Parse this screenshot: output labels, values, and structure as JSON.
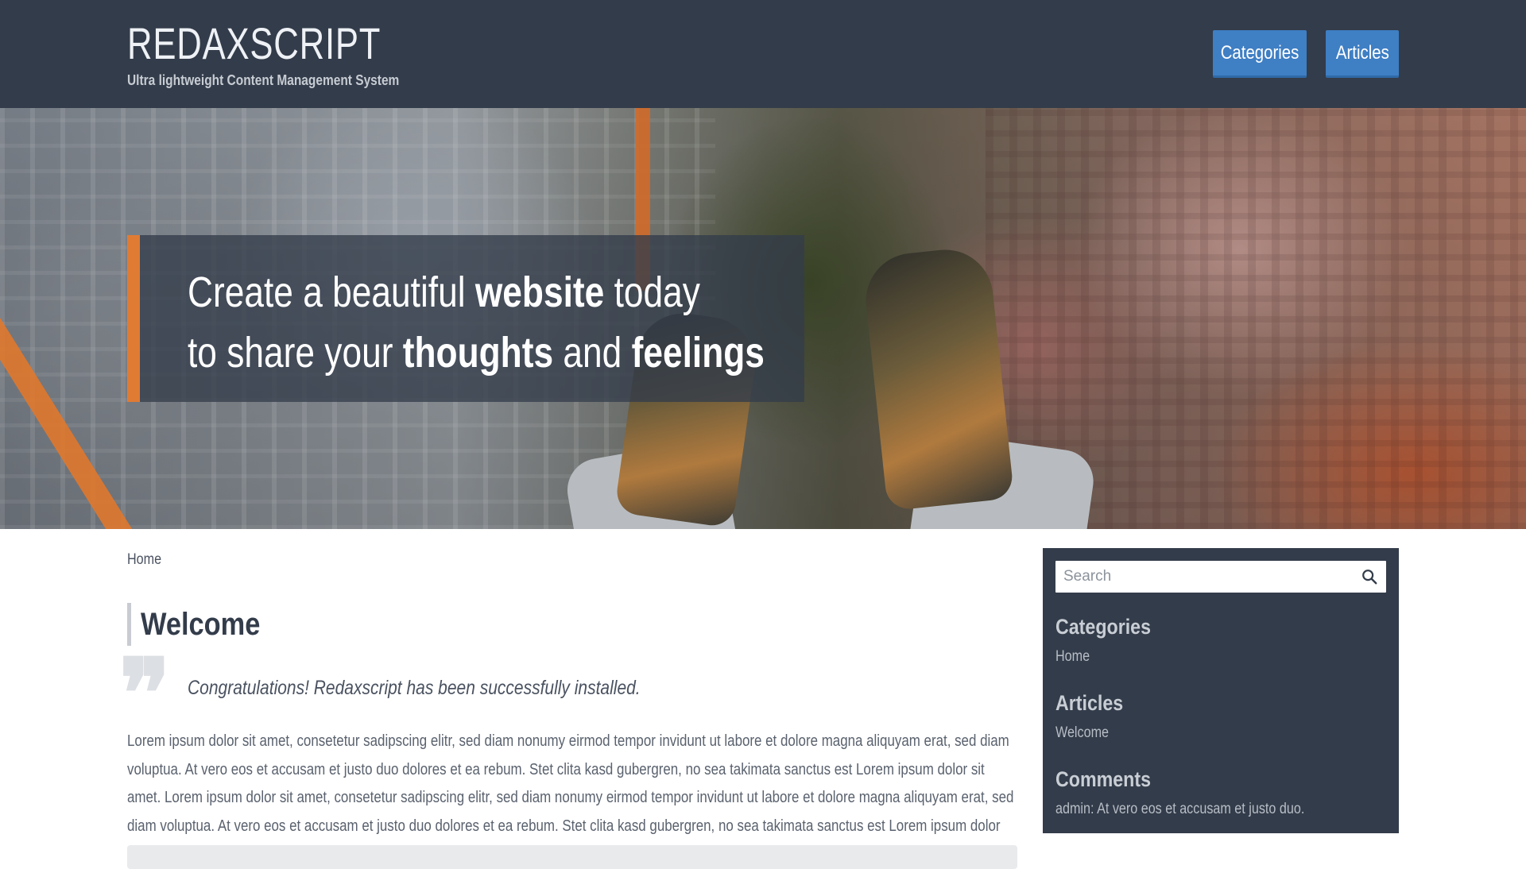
{
  "header": {
    "title": "REDAXSCRIPT",
    "subtitle": "Ultra lightweight Content Management System",
    "nav": [
      {
        "label": "Categories"
      },
      {
        "label": "Articles"
      }
    ]
  },
  "hero": {
    "line1_a": "Create a beautiful ",
    "line1_b": "website",
    "line1_c": " today",
    "line2_a": "to share your ",
    "line2_b": "thoughts",
    "line2_c": " and ",
    "line2_d": "feelings"
  },
  "main": {
    "breadcrumb": "Home",
    "title": "Welcome",
    "quote_mark": "❞",
    "lead": "Congratulations! Redaxscript has been successfully installed.",
    "body": "Lorem ipsum dolor sit amet, consetetur sadipscing elitr, sed diam nonumy eirmod tempor invidunt ut labore et dolore magna aliquyam erat, sed diam voluptua. At vero eos et accusam et justo duo dolores et ea rebum. Stet clita kasd gubergren, no sea takimata sanctus est Lorem ipsum dolor sit amet. Lorem ipsum dolor sit amet, consetetur sadipscing elitr, sed diam nonumy eirmod tempor invidunt ut labore et dolore magna aliquyam erat, sed diam voluptua. At vero eos et accusam et justo duo dolores et ea rebum. Stet clita kasd gubergren, no sea takimata sanctus est Lorem ipsum dolor sit amet."
  },
  "sidebar": {
    "search_placeholder": "Search",
    "categories_heading": "Categories",
    "categories_item": "Home",
    "articles_heading": "Articles",
    "articles_item": "Welcome",
    "comments_heading": "Comments",
    "comments_item": "admin: At vero eos et accusam et justo duo."
  },
  "colors": {
    "header_bg": "#333c4a",
    "nav_button": "#3f7fc4",
    "hero_accent": "#e07b34"
  },
  "icons": {
    "search": "search-icon"
  }
}
